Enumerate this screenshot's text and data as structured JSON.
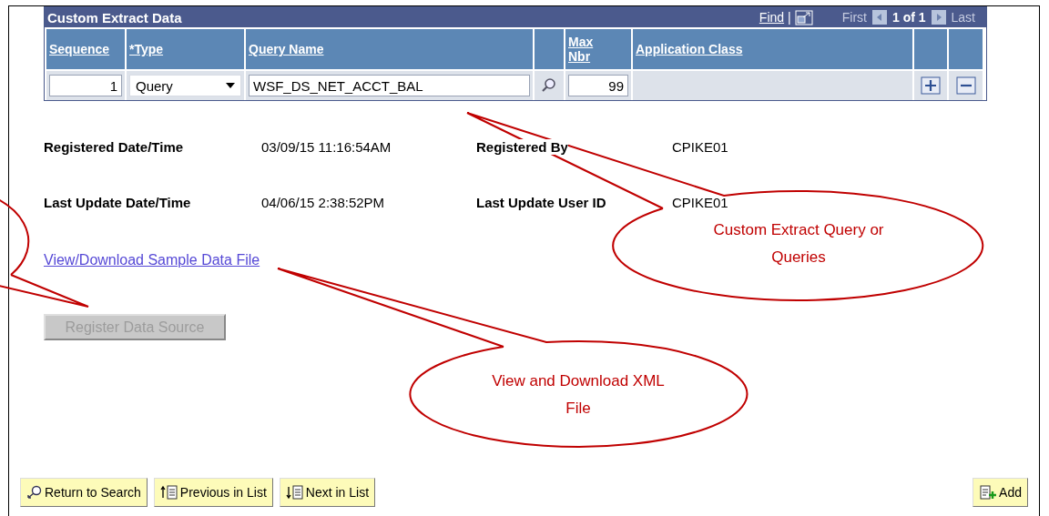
{
  "panel": {
    "title": "Custom Extract Data",
    "find": "Find",
    "separator": "|",
    "first": "First",
    "count": "1 of 1",
    "last": "Last"
  },
  "columns": [
    "Sequence",
    "*Type",
    "Query Name",
    "Max Nbr",
    "Application Class"
  ],
  "rows": [
    {
      "sequence": "1",
      "type": "Query",
      "query_name": "WSF_DS_NET_ACCT_BAL",
      "max_nbr": "99"
    }
  ],
  "fields": [
    {
      "label": "Registered Date/Time",
      "value": "03/09/15 11:16:54AM"
    },
    {
      "label": "Registered By",
      "value": "CPIKE01"
    },
    {
      "label": "Last Update Date/Time",
      "value": "04/06/15  2:38:52PM"
    },
    {
      "label": "Last Update User ID",
      "value": "CPIKE01"
    }
  ],
  "link": "View/Download Sample Data File",
  "register_button": {
    "label": "Register Data Source",
    "disabled": true
  },
  "toolbar": [
    {
      "label": "Return to Search",
      "kind": "search"
    },
    {
      "label": "Previous in List",
      "kind": "previous"
    },
    {
      "label": "Next in List",
      "kind": "next"
    }
  ],
  "add_button": "Add",
  "callouts": [
    {
      "text": "Custom Extract Query or Queries"
    },
    {
      "text": "View and Download XML File"
    }
  ]
}
